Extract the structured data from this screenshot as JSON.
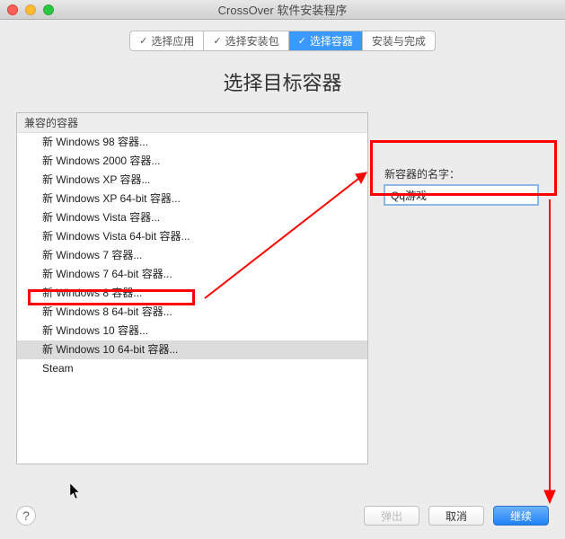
{
  "window": {
    "title": "CrossOver 软件安装程序"
  },
  "steps": [
    {
      "label": "选择应用",
      "done": true,
      "active": false
    },
    {
      "label": "选择安装包",
      "done": true,
      "active": false
    },
    {
      "label": "选择容器",
      "done": true,
      "active": true
    },
    {
      "label": "安装与完成",
      "done": false,
      "active": false
    }
  ],
  "main_heading": "选择目标容器",
  "list": {
    "header": "兼容的容器",
    "items": [
      {
        "label": "新 Windows 98 容器...",
        "selected": false
      },
      {
        "label": "新 Windows 2000 容器...",
        "selected": false
      },
      {
        "label": "新 Windows XP 容器...",
        "selected": false
      },
      {
        "label": "新 Windows XP 64-bit 容器...",
        "selected": false
      },
      {
        "label": "新 Windows Vista 容器...",
        "selected": false
      },
      {
        "label": "新 Windows Vista 64-bit 容器...",
        "selected": false
      },
      {
        "label": "新 Windows 7 容器...",
        "selected": false
      },
      {
        "label": "新 Windows 7 64-bit 容器...",
        "selected": false
      },
      {
        "label": "新 Windows 8 容器...",
        "selected": false
      },
      {
        "label": "新 Windows 8 64-bit 容器...",
        "selected": false
      },
      {
        "label": "新 Windows 10 容器...",
        "selected": false
      },
      {
        "label": "新 Windows 10 64-bit 容器...",
        "selected": true
      },
      {
        "label": "Steam",
        "selected": false
      }
    ]
  },
  "name_field": {
    "label": "新容器的名字：",
    "value": "Qq游戏"
  },
  "footer": {
    "help_tooltip": "?",
    "eject": "弹出",
    "cancel": "取消",
    "continue": "继续"
  }
}
